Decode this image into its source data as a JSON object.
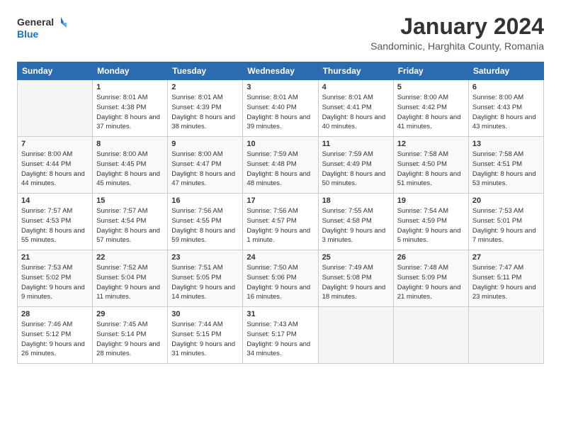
{
  "header": {
    "logo_line1": "General",
    "logo_line2": "Blue",
    "month": "January 2024",
    "location": "Sandominic, Harghita County, Romania"
  },
  "weekdays": [
    "Sunday",
    "Monday",
    "Tuesday",
    "Wednesday",
    "Thursday",
    "Friday",
    "Saturday"
  ],
  "weeks": [
    [
      {
        "day": "",
        "empty": true
      },
      {
        "day": "1",
        "sunrise": "8:01 AM",
        "sunset": "4:38 PM",
        "daylight": "8 hours and 37 minutes."
      },
      {
        "day": "2",
        "sunrise": "8:01 AM",
        "sunset": "4:39 PM",
        "daylight": "8 hours and 38 minutes."
      },
      {
        "day": "3",
        "sunrise": "8:01 AM",
        "sunset": "4:40 PM",
        "daylight": "8 hours and 39 minutes."
      },
      {
        "day": "4",
        "sunrise": "8:01 AM",
        "sunset": "4:41 PM",
        "daylight": "8 hours and 40 minutes."
      },
      {
        "day": "5",
        "sunrise": "8:00 AM",
        "sunset": "4:42 PM",
        "daylight": "8 hours and 41 minutes."
      },
      {
        "day": "6",
        "sunrise": "8:00 AM",
        "sunset": "4:43 PM",
        "daylight": "8 hours and 43 minutes."
      }
    ],
    [
      {
        "day": "7",
        "sunrise": "8:00 AM",
        "sunset": "4:44 PM",
        "daylight": "8 hours and 44 minutes."
      },
      {
        "day": "8",
        "sunrise": "8:00 AM",
        "sunset": "4:45 PM",
        "daylight": "8 hours and 45 minutes."
      },
      {
        "day": "9",
        "sunrise": "8:00 AM",
        "sunset": "4:47 PM",
        "daylight": "8 hours and 47 minutes."
      },
      {
        "day": "10",
        "sunrise": "7:59 AM",
        "sunset": "4:48 PM",
        "daylight": "8 hours and 48 minutes."
      },
      {
        "day": "11",
        "sunrise": "7:59 AM",
        "sunset": "4:49 PM",
        "daylight": "8 hours and 50 minutes."
      },
      {
        "day": "12",
        "sunrise": "7:58 AM",
        "sunset": "4:50 PM",
        "daylight": "8 hours and 51 minutes."
      },
      {
        "day": "13",
        "sunrise": "7:58 AM",
        "sunset": "4:51 PM",
        "daylight": "8 hours and 53 minutes."
      }
    ],
    [
      {
        "day": "14",
        "sunrise": "7:57 AM",
        "sunset": "4:53 PM",
        "daylight": "8 hours and 55 minutes."
      },
      {
        "day": "15",
        "sunrise": "7:57 AM",
        "sunset": "4:54 PM",
        "daylight": "8 hours and 57 minutes."
      },
      {
        "day": "16",
        "sunrise": "7:56 AM",
        "sunset": "4:55 PM",
        "daylight": "8 hours and 59 minutes."
      },
      {
        "day": "17",
        "sunrise": "7:56 AM",
        "sunset": "4:57 PM",
        "daylight": "9 hours and 1 minute."
      },
      {
        "day": "18",
        "sunrise": "7:55 AM",
        "sunset": "4:58 PM",
        "daylight": "9 hours and 3 minutes."
      },
      {
        "day": "19",
        "sunrise": "7:54 AM",
        "sunset": "4:59 PM",
        "daylight": "9 hours and 5 minutes."
      },
      {
        "day": "20",
        "sunrise": "7:53 AM",
        "sunset": "5:01 PM",
        "daylight": "9 hours and 7 minutes."
      }
    ],
    [
      {
        "day": "21",
        "sunrise": "7:53 AM",
        "sunset": "5:02 PM",
        "daylight": "9 hours and 9 minutes."
      },
      {
        "day": "22",
        "sunrise": "7:52 AM",
        "sunset": "5:04 PM",
        "daylight": "9 hours and 11 minutes."
      },
      {
        "day": "23",
        "sunrise": "7:51 AM",
        "sunset": "5:05 PM",
        "daylight": "9 hours and 14 minutes."
      },
      {
        "day": "24",
        "sunrise": "7:50 AM",
        "sunset": "5:06 PM",
        "daylight": "9 hours and 16 minutes."
      },
      {
        "day": "25",
        "sunrise": "7:49 AM",
        "sunset": "5:08 PM",
        "daylight": "9 hours and 18 minutes."
      },
      {
        "day": "26",
        "sunrise": "7:48 AM",
        "sunset": "5:09 PM",
        "daylight": "9 hours and 21 minutes."
      },
      {
        "day": "27",
        "sunrise": "7:47 AM",
        "sunset": "5:11 PM",
        "daylight": "9 hours and 23 minutes."
      }
    ],
    [
      {
        "day": "28",
        "sunrise": "7:46 AM",
        "sunset": "5:12 PM",
        "daylight": "9 hours and 26 minutes."
      },
      {
        "day": "29",
        "sunrise": "7:45 AM",
        "sunset": "5:14 PM",
        "daylight": "9 hours and 28 minutes."
      },
      {
        "day": "30",
        "sunrise": "7:44 AM",
        "sunset": "5:15 PM",
        "daylight": "9 hours and 31 minutes."
      },
      {
        "day": "31",
        "sunrise": "7:43 AM",
        "sunset": "5:17 PM",
        "daylight": "9 hours and 34 minutes."
      },
      {
        "day": "",
        "empty": true
      },
      {
        "day": "",
        "empty": true
      },
      {
        "day": "",
        "empty": true
      }
    ]
  ]
}
